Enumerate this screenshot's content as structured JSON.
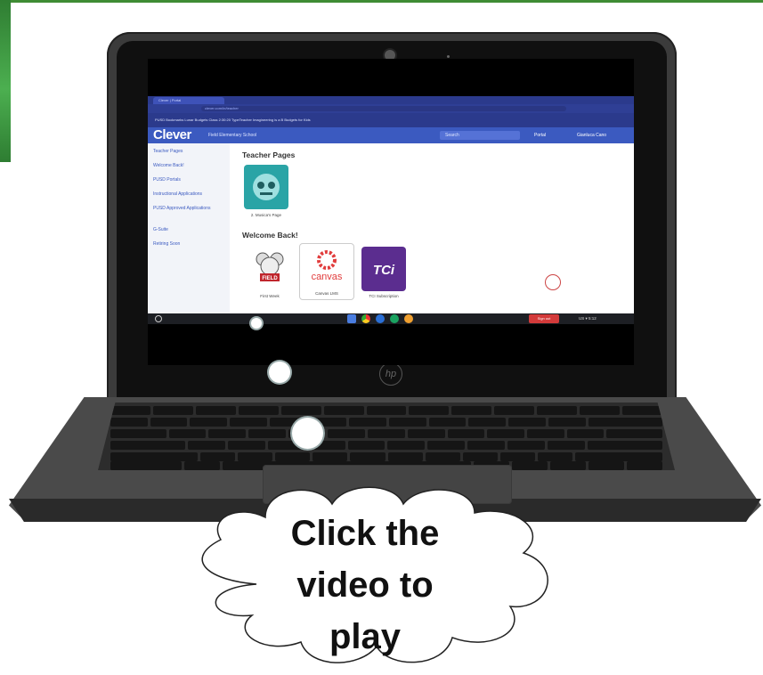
{
  "browser": {
    "tab_title": "Clever | Portal",
    "address": "clever.com/in/teacher",
    "bookmarks": "PUSD Bookmarks    Lunar Budgets    Class    2:30:20    TypeTeacher    Imagineering is a B    Budgets for Kids"
  },
  "clever": {
    "logo": "Clever",
    "school": "Field Elementary School",
    "search_placeholder": "Search",
    "portal_label": "Portal",
    "user_label": "Gianluca Cano"
  },
  "sidebar": {
    "items": [
      {
        "label": "Teacher Pages"
      },
      {
        "label": "Welcome Back!"
      },
      {
        "label": "PUSD Portals"
      },
      {
        "label": "Instructional Applications"
      },
      {
        "label": "PUSD Approved Applications"
      },
      {
        "label": "G-Suite"
      },
      {
        "label": "Retiring Soon"
      }
    ]
  },
  "main": {
    "teacher_pages_title": "Teacher Pages",
    "teacher_page_app": {
      "label": "2. Musica's Page"
    },
    "welcome_title": "Welcome Back!",
    "apps": [
      {
        "label": "First Week",
        "tile_text": "FIELD"
      },
      {
        "label": "Canvas LMS",
        "tile_text": "canvas"
      },
      {
        "label": "TCI Subscription",
        "tile_text": "TCi"
      }
    ]
  },
  "taskbar": {
    "signout_label": "Sign out",
    "tray_text": "US  ▾  5:12"
  },
  "callout": {
    "text": "Click the\nvideo to\nplay"
  },
  "colors": {
    "clever_blue": "#3b5ac0",
    "slide_green": "#3f8c34",
    "canvas_red": "#e13c3c",
    "tci_purple": "#5b2d8f"
  }
}
